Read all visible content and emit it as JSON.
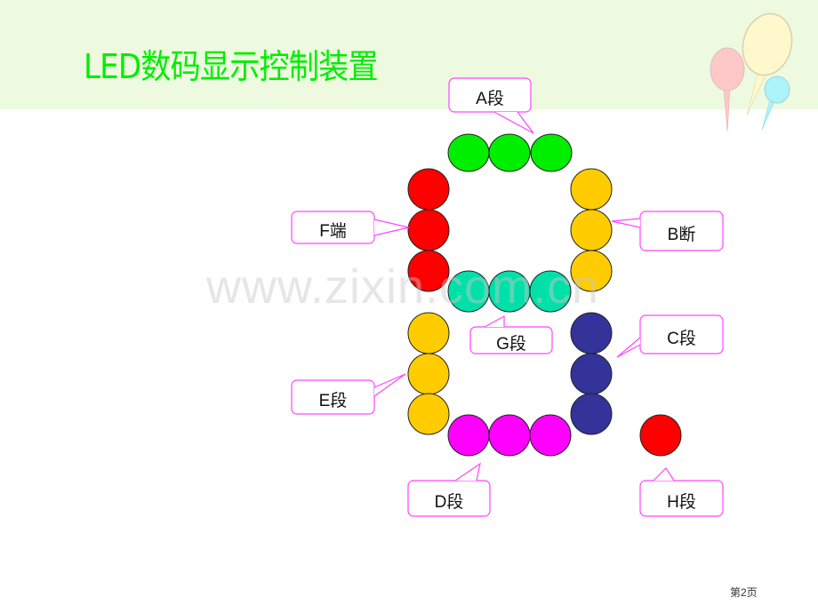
{
  "slide": {
    "title": "LED数码显示控制装置",
    "watermark": "www.zixin.com.cn",
    "page_number": "第2页",
    "header_color": "#eefae0",
    "title_color": "#00ee00",
    "callout_border_color": "#ff44ff"
  },
  "segments": [
    {
      "id": "A",
      "label": "A段",
      "color": "#00ee00"
    },
    {
      "id": "B",
      "label": "B断",
      "color": "#ffcc00"
    },
    {
      "id": "C",
      "label": "C段",
      "color": "#333399"
    },
    {
      "id": "D",
      "label": "D段",
      "color": "#ff00ff"
    },
    {
      "id": "E",
      "label": "E段",
      "color": "#ffcc00"
    },
    {
      "id": "F",
      "label": "F端",
      "color": "#ff0000"
    },
    {
      "id": "G",
      "label": "G段",
      "color": "#00e0a8"
    },
    {
      "id": "H",
      "label": "H段",
      "color": "#ff0000"
    }
  ],
  "decoration": {
    "balloons": [
      {
        "name": "pink-balloon",
        "color": "#ffc8c8"
      },
      {
        "name": "yellow-balloon",
        "color": "#fff8cc"
      },
      {
        "name": "cyan-balloon",
        "color": "#aaf4fa"
      }
    ]
  }
}
